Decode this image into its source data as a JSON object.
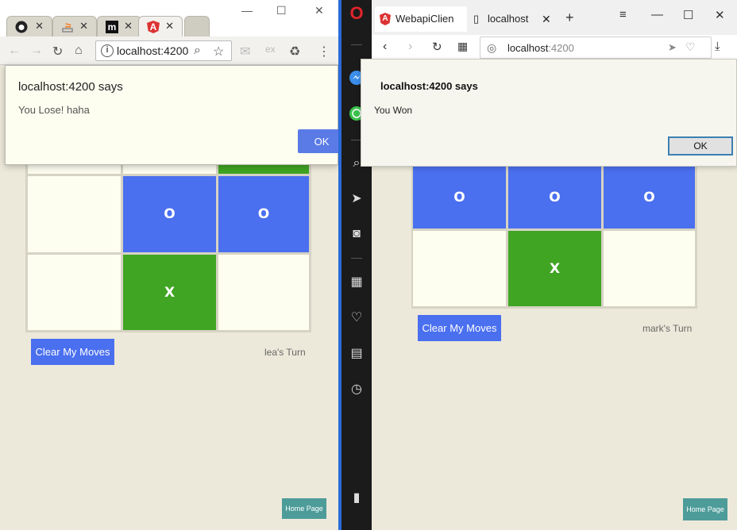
{
  "left_browser": {
    "tabs": [
      {
        "icon": "github-icon",
        "close": "✕"
      },
      {
        "icon": "stackoverflow-icon",
        "close": "✕"
      },
      {
        "icon": "m-logo-icon",
        "label": "m",
        "close": "✕"
      },
      {
        "icon": "angular-icon",
        "label": "A",
        "close": "✕"
      }
    ],
    "url": "localhost:4200",
    "alert": {
      "title": "localhost:4200 says",
      "message": "You Lose! haha",
      "ok_label": "OK"
    },
    "board": [
      [
        "",
        "",
        "X"
      ],
      [
        "",
        "O",
        "O"
      ],
      [
        "",
        "X",
        ""
      ]
    ],
    "clear_button_label": "Clear My Moves",
    "turn_text": "lea's Turn",
    "home_button_label": "Home Page"
  },
  "right_browser": {
    "tabs": [
      {
        "label": "WebapiClien",
        "icon": "angular-icon"
      },
      {
        "label": "localhost",
        "icon": "page-icon"
      }
    ],
    "url_host": "localhost",
    "url_port": ":4200",
    "alert": {
      "title": "localhost:4200 says",
      "message": "You Won",
      "ok_label": "OK"
    },
    "board": [
      [
        "O",
        "O",
        "O"
      ],
      [
        "",
        "X",
        ""
      ]
    ],
    "clear_button_label": "Clear My Moves",
    "turn_text": "mark's Turn",
    "home_button_label": "Home Page"
  },
  "colors": {
    "o_cell": "#4a6fef",
    "x_cell": "#40a522",
    "empty_cell": "#fdfdf0",
    "page_bg": "#ede9da",
    "home_button": "#4d9c9a"
  }
}
